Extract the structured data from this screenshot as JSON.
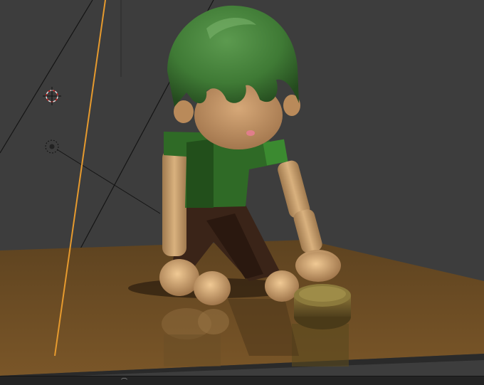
{
  "app": "Blender",
  "view": {
    "mode": "rendered-viewport",
    "shading": "cycles-preview"
  },
  "colors": {
    "background": "#3d3d3d",
    "floor": "#6b4c24",
    "hair": "#3f7a35",
    "shirt": "#2f6a26",
    "skin": "#d8ad78",
    "pants": "#3a2418",
    "button": "#6e5a2c",
    "camera_line": "#e69a2e",
    "guide_lines": "#111111"
  },
  "objects": [
    {
      "name": "3d-cursor-icon"
    },
    {
      "name": "light-object-icon"
    },
    {
      "name": "character"
    },
    {
      "name": "floor-plane"
    },
    {
      "name": "round-button-prop"
    }
  ],
  "statusbar": {
    "icon": "mouse-icon"
  }
}
